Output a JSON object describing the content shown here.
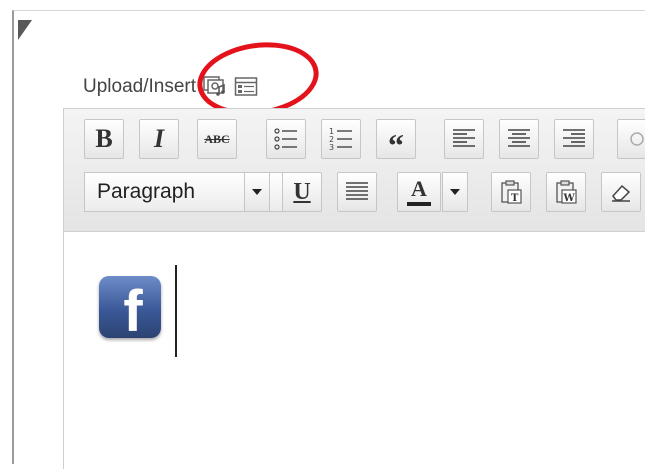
{
  "upload": {
    "label": "Upload/Insert"
  },
  "icons": {
    "add_media": "add-media-icon",
    "add_form": "add-form-icon"
  },
  "toolbar": {
    "bold_label": "B",
    "italic_label": "I",
    "strikethrough_label": "ABC",
    "blockquote_label": "“",
    "underline_label": "U",
    "format_select": {
      "value": "Paragraph"
    },
    "text_color_label": "A"
  },
  "editor": {
    "image": {
      "letter": "f"
    }
  },
  "colors": {
    "highlight": "#e3121b",
    "facebook_blue": "#3b5998",
    "toolbar_bg": "#e8e8e8"
  }
}
